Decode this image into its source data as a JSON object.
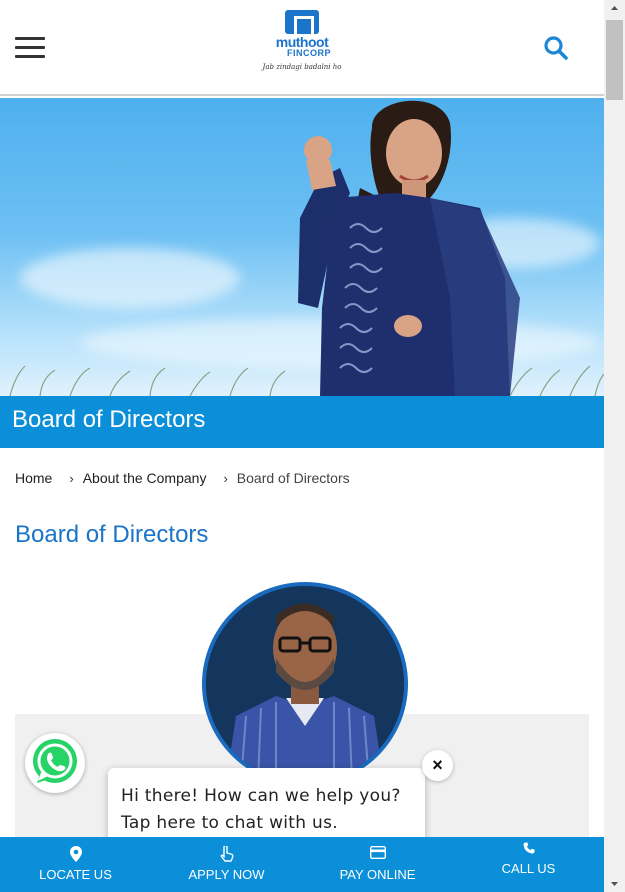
{
  "header": {
    "brand_name": "muthoot",
    "brand_sub": "FINCORP",
    "brand_tagline": "Jab zindagi badalni ho"
  },
  "banner": {
    "title": "Board of Directors"
  },
  "breadcrumb": {
    "items": [
      "Home",
      "About the Company",
      "Board of Directors"
    ]
  },
  "section": {
    "title": "Board of Directors"
  },
  "chat": {
    "message": "Hi there! How can we help you? Tap here to chat with us.",
    "close_label": "×"
  },
  "bottom_nav": {
    "items": [
      {
        "label": "LOCATE US",
        "icon": "location-pin-icon"
      },
      {
        "label": "APPLY NOW",
        "icon": "hand-pointer-icon"
      },
      {
        "label": "PAY ONLINE",
        "icon": "credit-card-icon"
      },
      {
        "label": "CALL US",
        "icon": "phone-icon"
      }
    ]
  },
  "colors": {
    "brand_blue": "#1a74c9",
    "banner_blue": "#0a8fd8",
    "whatsapp_green": "#25d366"
  }
}
